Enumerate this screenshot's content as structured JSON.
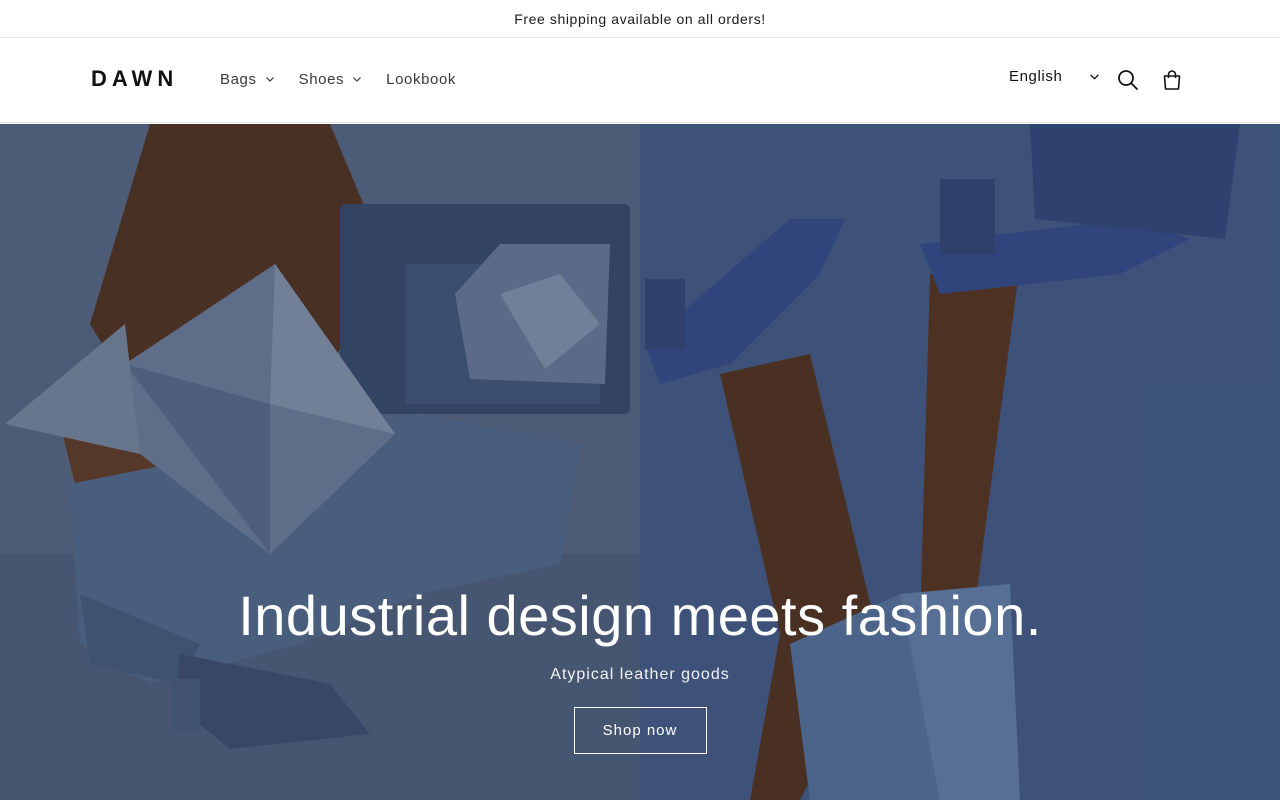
{
  "announcement": {
    "text": "Free shipping available on all orders!"
  },
  "header": {
    "logo": "DAWN",
    "nav": [
      {
        "label": "Bags",
        "has_dropdown": true
      },
      {
        "label": "Shoes",
        "has_dropdown": true
      },
      {
        "label": "Lookbook",
        "has_dropdown": false
      }
    ],
    "language": {
      "selected": "English"
    },
    "icons": {
      "search": "search-icon",
      "cart": "cart-icon"
    }
  },
  "hero": {
    "heading": "Industrial design meets fashion.",
    "subheading": "Atypical leather goods",
    "button_label": "Shop now"
  },
  "colors": {
    "text": "#121212",
    "background": "#ffffff",
    "hero_blue_left": "#5c6f8f",
    "hero_blue_right": "#4a6493"
  }
}
